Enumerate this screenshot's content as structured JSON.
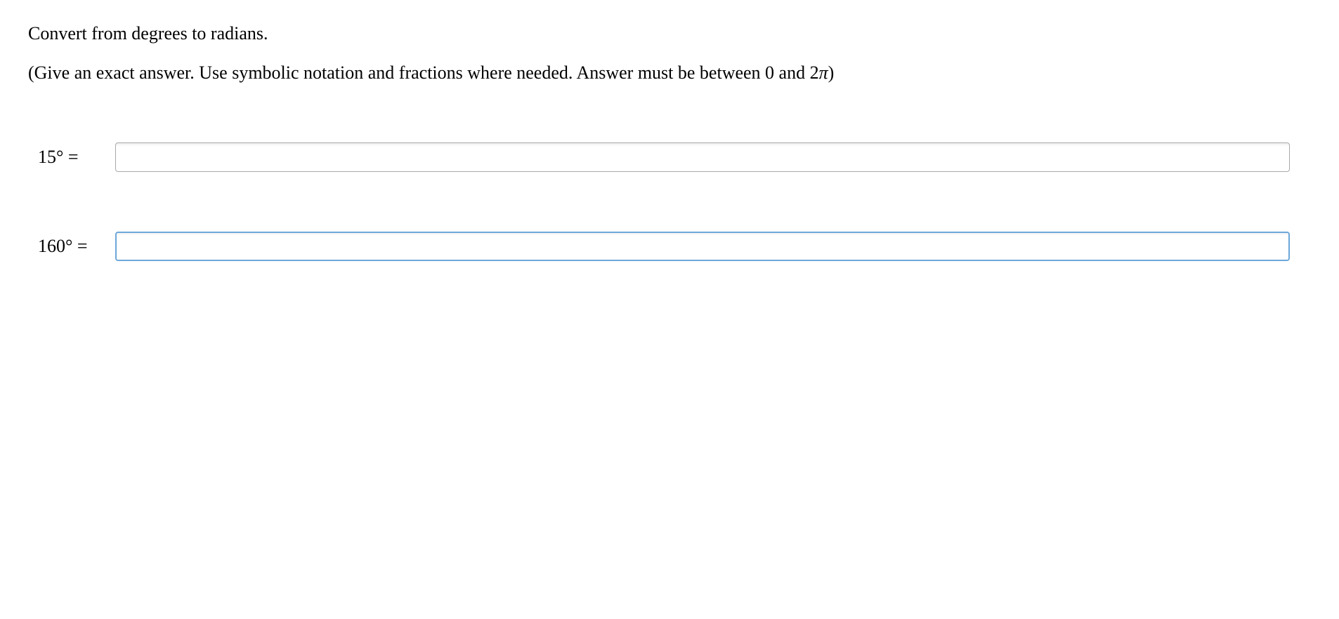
{
  "problem": {
    "title": "Convert from degrees to radians.",
    "instruction_prefix": "(Give an exact answer. Use symbolic notation and fractions where needed. Answer must be between 0 and 2",
    "instruction_pi": "π",
    "instruction_suffix": ")"
  },
  "questions": [
    {
      "label": "15°  =",
      "value": "",
      "focused": false
    },
    {
      "label": "160°  =",
      "value": "",
      "focused": true
    }
  ]
}
